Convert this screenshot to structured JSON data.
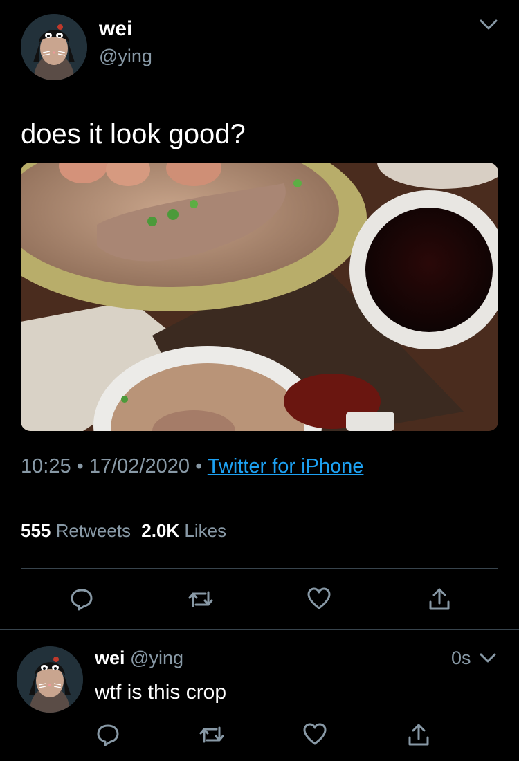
{
  "main_tweet": {
    "display_name": "wei",
    "handle": "@ying",
    "text": "does it look good?",
    "time": "10:25",
    "separator": "•",
    "date": "17/02/2020",
    "source": "Twitter for iPhone",
    "retweets_count": "555",
    "retweets_label": "Retweets",
    "likes_count": "2.0K",
    "likes_label": "Likes"
  },
  "reply": {
    "display_name": "wei",
    "handle": "@ying",
    "timestamp": "0s",
    "text": "wtf is this crop"
  },
  "icons": {
    "reply": "reply-icon",
    "retweet": "retweet-icon",
    "like": "heart-icon",
    "share": "share-icon",
    "caret": "chevron-down-icon"
  },
  "colors": {
    "background": "#000000",
    "muted": "#8899a6",
    "link": "#1da1f2",
    "divider": "#38444d"
  }
}
